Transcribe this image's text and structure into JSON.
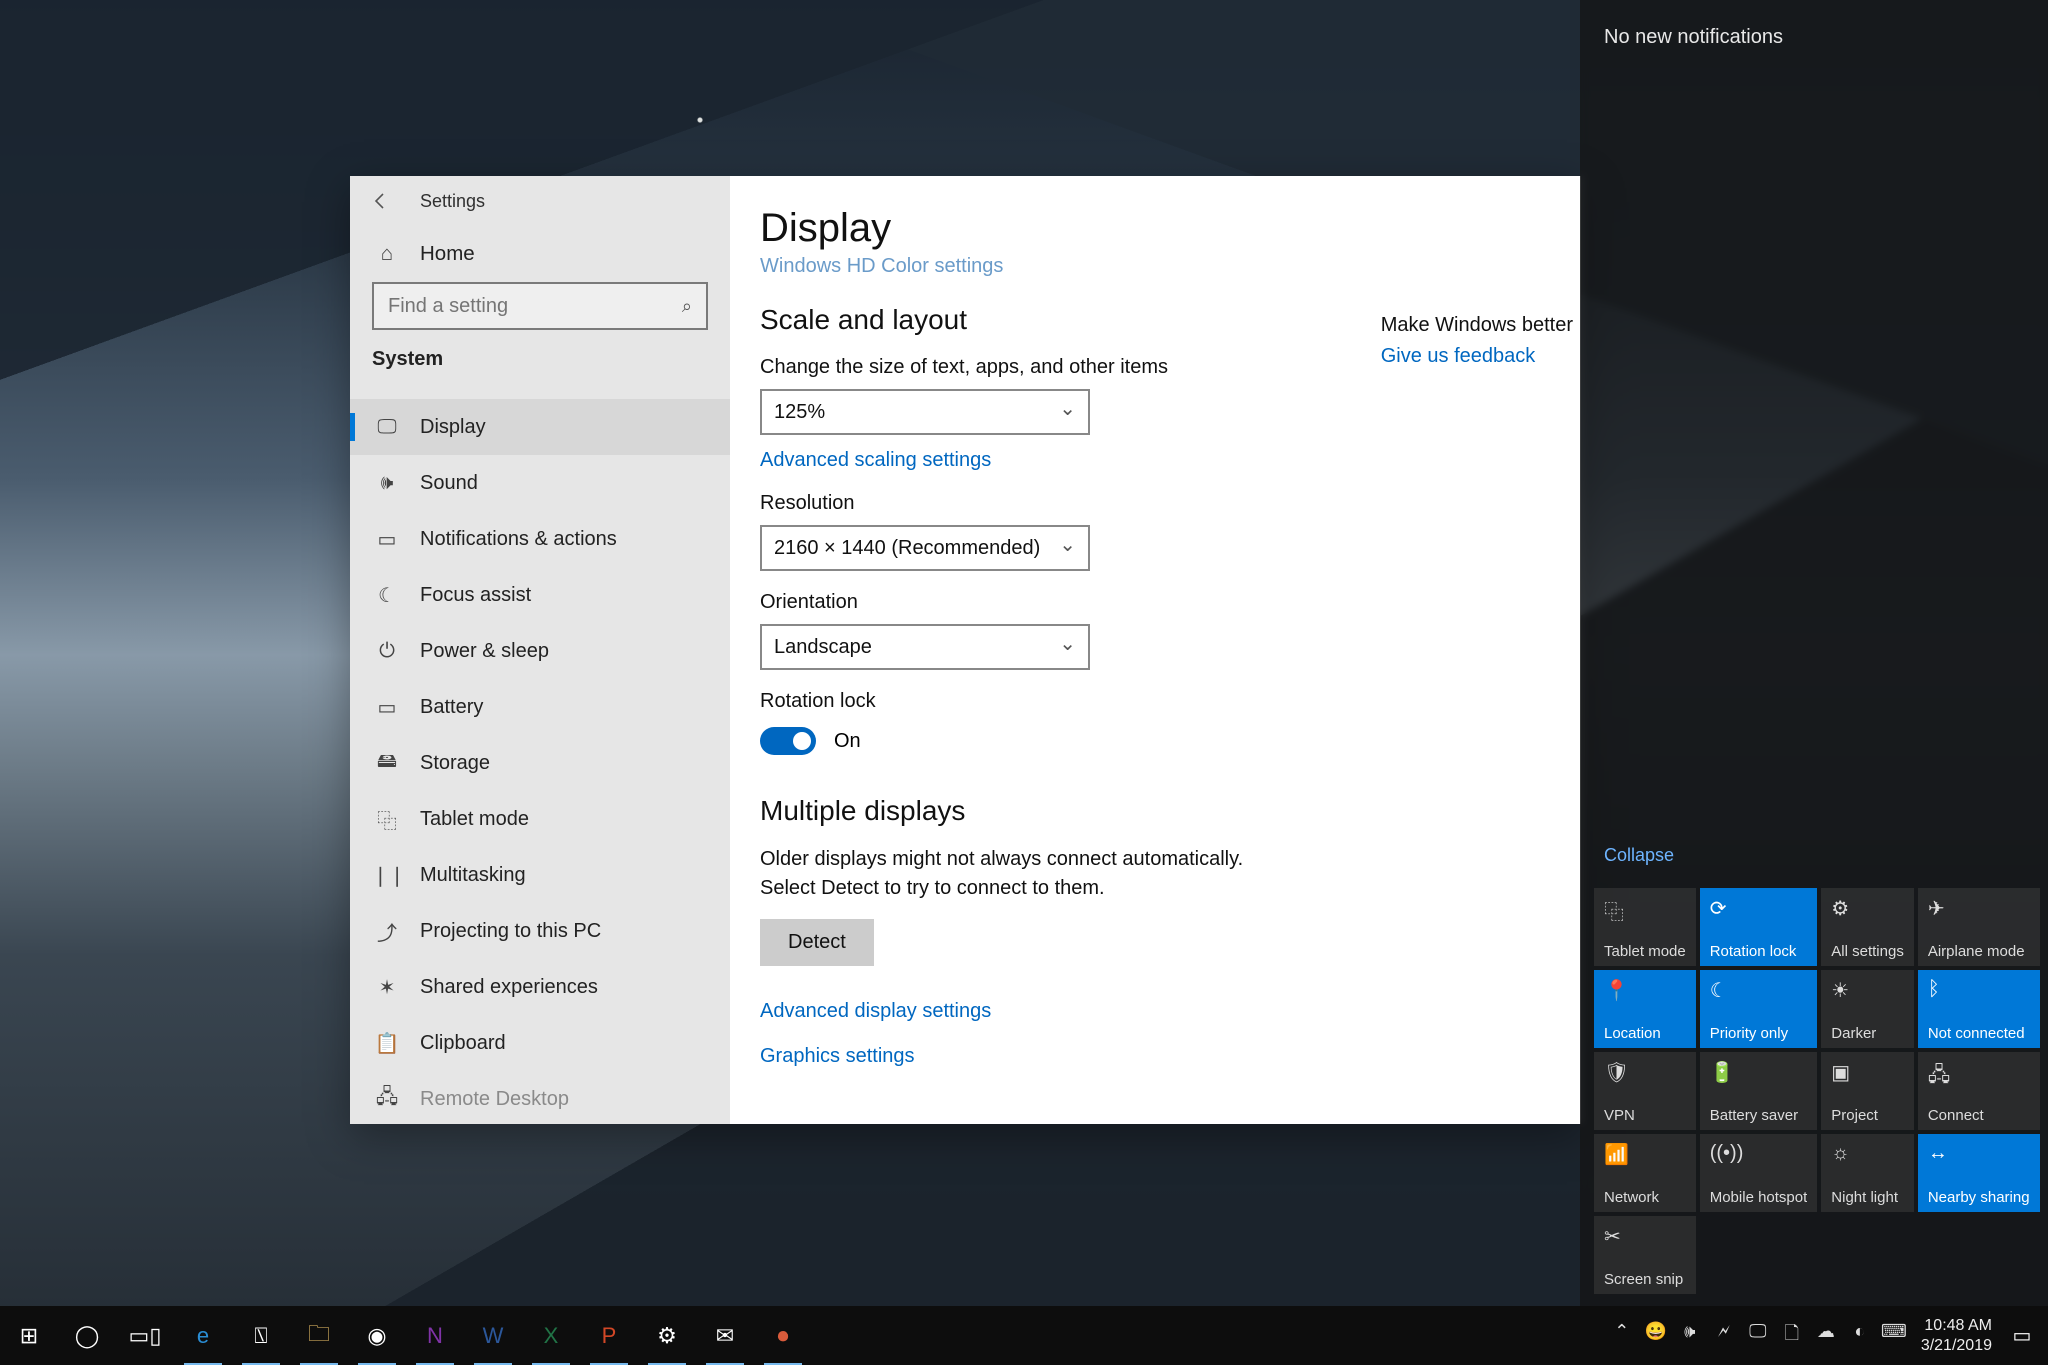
{
  "window": {
    "title": "Settings",
    "home_label": "Home",
    "search_placeholder": "Find a setting",
    "group": "System",
    "nav": [
      {
        "icon": "display-icon",
        "label": "Display",
        "active": true
      },
      {
        "icon": "sound-icon",
        "label": "Sound"
      },
      {
        "icon": "notifications-icon",
        "label": "Notifications & actions"
      },
      {
        "icon": "focus-icon",
        "label": "Focus assist"
      },
      {
        "icon": "power-icon",
        "label": "Power & sleep"
      },
      {
        "icon": "battery-icon",
        "label": "Battery"
      },
      {
        "icon": "storage-icon",
        "label": "Storage"
      },
      {
        "icon": "tablet-icon",
        "label": "Tablet mode"
      },
      {
        "icon": "multitask-icon",
        "label": "Multitasking"
      },
      {
        "icon": "projecting-icon",
        "label": "Projecting to this PC"
      },
      {
        "icon": "shared-icon",
        "label": "Shared experiences"
      },
      {
        "icon": "clipboard-icon",
        "label": "Clipboard"
      },
      {
        "icon": "remote-icon",
        "label": "Remote Desktop",
        "truncated": true
      }
    ]
  },
  "display": {
    "page_title": "Display",
    "hd_color_link": "Windows HD Color settings",
    "section_scale": "Scale and layout",
    "scale_label": "Change the size of text, apps, and other items",
    "scale_value": "125%",
    "adv_scaling": "Advanced scaling settings",
    "resolution_label": "Resolution",
    "resolution_value": "2160 × 1440 (Recommended)",
    "orientation_label": "Orientation",
    "orientation_value": "Landscape",
    "rotation_label": "Rotation lock",
    "rotation_state": "On",
    "section_multi": "Multiple displays",
    "multi_body": "Older displays might not always connect automatically. Select Detect to try to connect to them.",
    "detect_btn": "Detect",
    "adv_display": "Advanced display settings",
    "graphics": "Graphics settings"
  },
  "right_rail": {
    "heading": "Make Windows better",
    "link": "Give us feedback"
  },
  "action_center": {
    "empty_msg": "No new notifications",
    "collapse": "Collapse",
    "tiles": [
      {
        "label": "Tablet mode",
        "on": false,
        "icon": "tablet-icon"
      },
      {
        "label": "Rotation lock",
        "on": true,
        "icon": "rotation-icon"
      },
      {
        "label": "All settings",
        "on": false,
        "icon": "gear-icon"
      },
      {
        "label": "Airplane mode",
        "on": false,
        "icon": "airplane-icon"
      },
      {
        "label": "Location",
        "on": true,
        "icon": "location-icon"
      },
      {
        "label": "Priority only",
        "on": true,
        "icon": "moon-icon"
      },
      {
        "label": "Darker",
        "on": false,
        "icon": "brightness-icon"
      },
      {
        "label": "Not connected",
        "on": true,
        "icon": "bluetooth-icon"
      },
      {
        "label": "VPN",
        "on": false,
        "icon": "vpn-icon"
      },
      {
        "label": "Battery saver",
        "on": false,
        "icon": "battery-icon"
      },
      {
        "label": "Project",
        "on": false,
        "icon": "project-icon"
      },
      {
        "label": "Connect",
        "on": false,
        "icon": "connect-icon"
      },
      {
        "label": "Network",
        "on": false,
        "icon": "network-icon"
      },
      {
        "label": "Mobile hotspot",
        "on": false,
        "icon": "hotspot-icon"
      },
      {
        "label": "Night light",
        "on": false,
        "icon": "nightlight-icon"
      },
      {
        "label": "Nearby sharing",
        "on": true,
        "icon": "nearby-icon"
      },
      {
        "label": "Screen snip",
        "on": false,
        "icon": "snip-icon"
      }
    ]
  },
  "taskbar": {
    "apps": [
      {
        "name": "start",
        "color": "#ffffff",
        "glyph": "⊞"
      },
      {
        "name": "cortana",
        "color": "#ffffff",
        "glyph": "◯"
      },
      {
        "name": "task-view",
        "color": "#ffffff",
        "glyph": "▭▯"
      },
      {
        "name": "edge",
        "color": "#2a8dd4",
        "glyph": "e",
        "running": true
      },
      {
        "name": "store",
        "color": "#ffffff",
        "glyph": "⍂",
        "running": true
      },
      {
        "name": "explorer",
        "color": "#f7c96b",
        "glyph": "🗀",
        "running": true
      },
      {
        "name": "chrome",
        "color": "#ffffff",
        "glyph": "◉",
        "running": true
      },
      {
        "name": "onenote",
        "color": "#8033a7",
        "glyph": "N",
        "running": true
      },
      {
        "name": "word",
        "color": "#2b579a",
        "glyph": "W",
        "running": true
      },
      {
        "name": "excel",
        "color": "#217346",
        "glyph": "X",
        "running": true
      },
      {
        "name": "powerpoint",
        "color": "#d24726",
        "glyph": "P",
        "running": true
      },
      {
        "name": "settings",
        "color": "#ffffff",
        "glyph": "⚙",
        "running": true
      },
      {
        "name": "mail",
        "color": "#ffffff",
        "glyph": "✉",
        "running": true
      },
      {
        "name": "recorder",
        "color": "#d95b3b",
        "glyph": "⏺",
        "running": true
      }
    ],
    "tray": [
      "⌃",
      "😀",
      "🕪",
      "🗲",
      "🖵",
      "🗋",
      "☁",
      "◐",
      "⌨"
    ],
    "time": "10:48 AM",
    "date": "3/21/2019"
  },
  "nav_glyphs": {
    "display-icon": "🖵",
    "sound-icon": "🕪",
    "notifications-icon": "▭",
    "focus-icon": "☾",
    "power-icon": "⏻",
    "battery-icon": "▭",
    "storage-icon": "🖴",
    "tablet-icon": "⿻",
    "multitask-icon": "❘❘",
    "projecting-icon": "⤴",
    "shared-icon": "✶",
    "clipboard-icon": "📋",
    "remote-icon": "🖧"
  },
  "qa_glyphs": {
    "tablet-icon": "⿻",
    "rotation-icon": "⟳",
    "gear-icon": "⚙",
    "airplane-icon": "✈",
    "location-icon": "📍",
    "moon-icon": "☾",
    "brightness-icon": "☀",
    "bluetooth-icon": "ᛒ",
    "vpn-icon": "🛡",
    "battery-icon": "🔋",
    "project-icon": "▣",
    "connect-icon": "🖧",
    "network-icon": "📶",
    "hotspot-icon": "((•))",
    "nightlight-icon": "☼",
    "nearby-icon": "↔",
    "snip-icon": "✂"
  }
}
